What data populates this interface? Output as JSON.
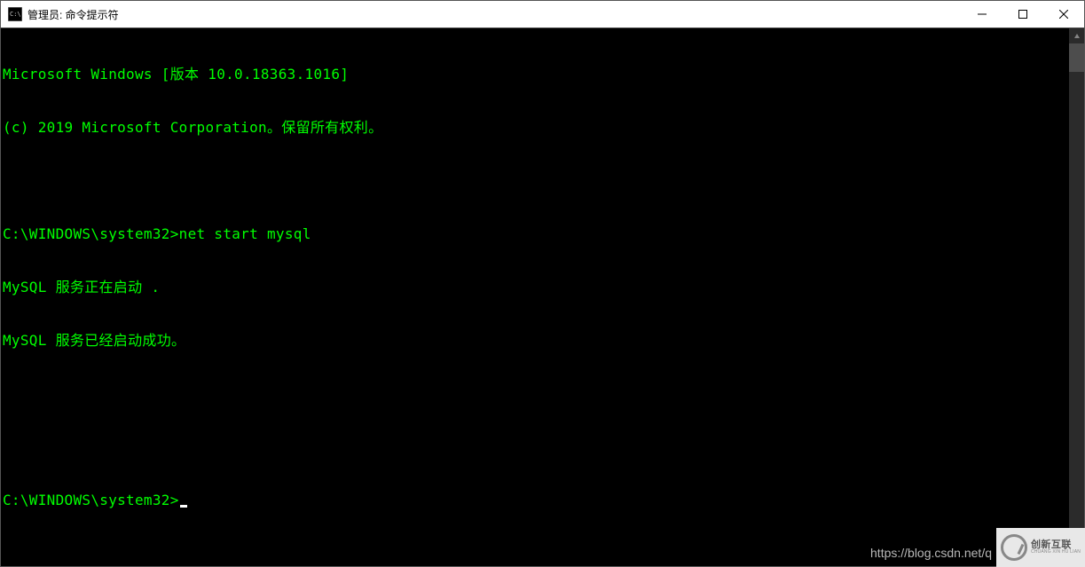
{
  "window": {
    "title": "管理员: 命令提示符"
  },
  "terminal": {
    "line1": "Microsoft Windows [版本 10.0.18363.1016]",
    "line2": "(c) 2019 Microsoft Corporation。保留所有权利。",
    "blank1": "",
    "prompt1": "C:\\WINDOWS\\system32>",
    "command1": "net start mysql",
    "output1": "MySQL 服务正在启动 .",
    "output2": "MySQL 服务已经启动成功。",
    "blank2": "",
    "blank3": "",
    "prompt2": "C:\\WINDOWS\\system32>"
  },
  "watermark": {
    "url": "https://blog.csdn.net/q",
    "logo_main": "创新互联",
    "logo_sub": "CHUANG XIN HU LIAN"
  }
}
